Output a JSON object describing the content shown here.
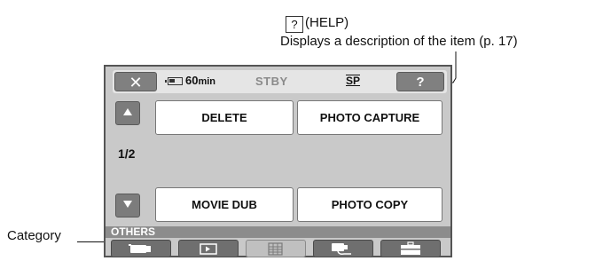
{
  "callout": {
    "help_icon": "?",
    "help_label": "(HELP)",
    "help_description": "Displays a description of the item (p. 17)"
  },
  "statusbar": {
    "close_icon": "✕",
    "battery_icon": "battery-icon",
    "battery_time": "60",
    "battery_unit": "min",
    "mode": "STBY",
    "recording_mode": "SP",
    "help_button": "?"
  },
  "menu": {
    "page": "1/2",
    "items": [
      {
        "label": "DELETE"
      },
      {
        "label": "PHOTO CAPTURE"
      },
      {
        "label": "MOVIE DUB"
      },
      {
        "label": "PHOTO COPY"
      }
    ]
  },
  "category": {
    "label": "OTHERS",
    "tabs": [
      {
        "icon": "camera-icon",
        "active": false
      },
      {
        "icon": "playback-icon",
        "active": false
      },
      {
        "icon": "others-icon",
        "active": true
      },
      {
        "icon": "edit-icon",
        "active": false
      },
      {
        "icon": "setup-icon",
        "active": false
      }
    ]
  },
  "category_callout": "Category"
}
